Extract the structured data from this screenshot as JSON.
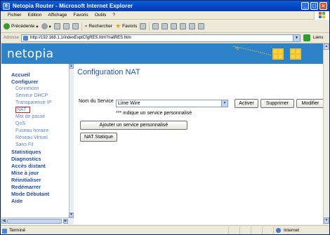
{
  "window": {
    "title": "Netopia Router - Microsoft Internet Explorer"
  },
  "menu": [
    "Fichier",
    "Edition",
    "Affichage",
    "Favoris",
    "Outils",
    "?"
  ],
  "toolbar": {
    "back_label": "Précédente",
    "search_label": "Rechercher",
    "favorites_label": "Favoris"
  },
  "address": {
    "label": "Adresse",
    "url": "http://192.168.1.1/indexExptCfgRES.htm?natRES.htm",
    "links_label": "Liens"
  },
  "header": {
    "logo": "netopia"
  },
  "nav": [
    {
      "label": "Accueil",
      "level": "main"
    },
    {
      "label": "Configurer",
      "level": "main"
    },
    {
      "label": "Connexion",
      "level": "sub"
    },
    {
      "label": "Serveur DHCP",
      "level": "sub"
    },
    {
      "label": "Transparence IP",
      "level": "sub"
    },
    {
      "label": "NAT",
      "level": "sub",
      "active": true
    },
    {
      "label": "Mot de passe",
      "level": "sub"
    },
    {
      "label": "QoS",
      "level": "sub"
    },
    {
      "label": "Fuseau horaire",
      "level": "sub"
    },
    {
      "label": "Réseau Virtuel",
      "level": "sub"
    },
    {
      "label": "Sans Fil",
      "level": "sub"
    },
    {
      "label": "Statistiques",
      "level": "main"
    },
    {
      "label": "Diagnostics",
      "level": "main"
    },
    {
      "label": "Accès distant",
      "level": "main"
    },
    {
      "label": "Mise à jour",
      "level": "main"
    },
    {
      "label": "Réinitialiser",
      "level": "main"
    },
    {
      "label": "Redémarrer",
      "level": "main"
    },
    {
      "label": "Mode Débutant",
      "level": "main"
    },
    {
      "label": "Aide",
      "level": "main"
    }
  ],
  "content": {
    "title": "Configuration NAT",
    "service_label": "Nom du Service",
    "service_value": "Lime Wire",
    "activate_label": "Activer",
    "delete_label": "Supprimer",
    "modify_label": "Modifier",
    "note": "*** indique un service personnalisé",
    "add_custom_label": "Ajouter un service personnalisé",
    "static_nat_label": "NAT Statique"
  },
  "status": {
    "left": "Terminé",
    "zone": "Internet"
  },
  "colors": {
    "header_blue": "#2e82c8",
    "nav_main": "#1f50a8",
    "nav_sub": "#5a86c8",
    "active_border": "#d02020"
  }
}
